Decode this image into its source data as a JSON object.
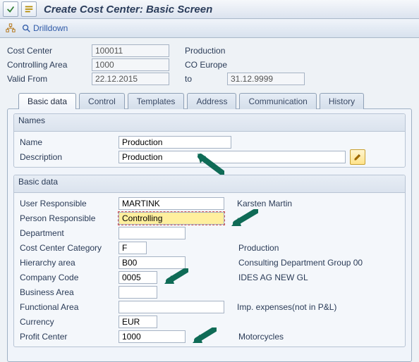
{
  "title": "Create Cost Center: Basic Screen",
  "subtoolbar": {
    "drilldown": "Drilldown"
  },
  "header": {
    "cost_center_label": "Cost Center",
    "cost_center_value": "100011",
    "cost_center_text": "Production",
    "controlling_area_label": "Controlling Area",
    "controlling_area_value": "1000",
    "controlling_area_text": "CO Europe",
    "valid_from_label": "Valid From",
    "valid_from_value": "22.12.2015",
    "to_label": "to",
    "valid_to_value": "31.12.9999"
  },
  "tabs": {
    "basic": "Basic data",
    "control": "Control",
    "templates": "Templates",
    "address": "Address",
    "communication": "Communication",
    "history": "History"
  },
  "groups": {
    "names_title": "Names",
    "basic_title": "Basic data"
  },
  "names": {
    "name_label": "Name",
    "name_value": "Production",
    "description_label": "Description",
    "description_value": "Production"
  },
  "basic": {
    "user_resp_label": "User Responsible",
    "user_resp_value": "MARTINK",
    "user_resp_text": "Karsten Martin",
    "person_resp_label": "Person Responsible",
    "person_resp_value": "Controlling",
    "department_label": "Department",
    "department_value": "",
    "cc_category_label": "Cost Center Category",
    "cc_category_value": "F",
    "cc_category_text": "Production",
    "hierarchy_label": "Hierarchy area",
    "hierarchy_value": "B00",
    "hierarchy_text": "Consulting Department Group 00",
    "company_code_label": "Company Code",
    "company_code_value": "0005",
    "company_code_text": "IDES AG NEW GL",
    "business_area_label": "Business Area",
    "business_area_value": "",
    "functional_area_label": "Functional Area",
    "functional_area_value": "",
    "functional_area_text": "Imp. expenses(not in P&L)",
    "currency_label": "Currency",
    "currency_value": "EUR",
    "profit_center_label": "Profit Center",
    "profit_center_value": "1000",
    "profit_center_text": "Motorcycles"
  }
}
